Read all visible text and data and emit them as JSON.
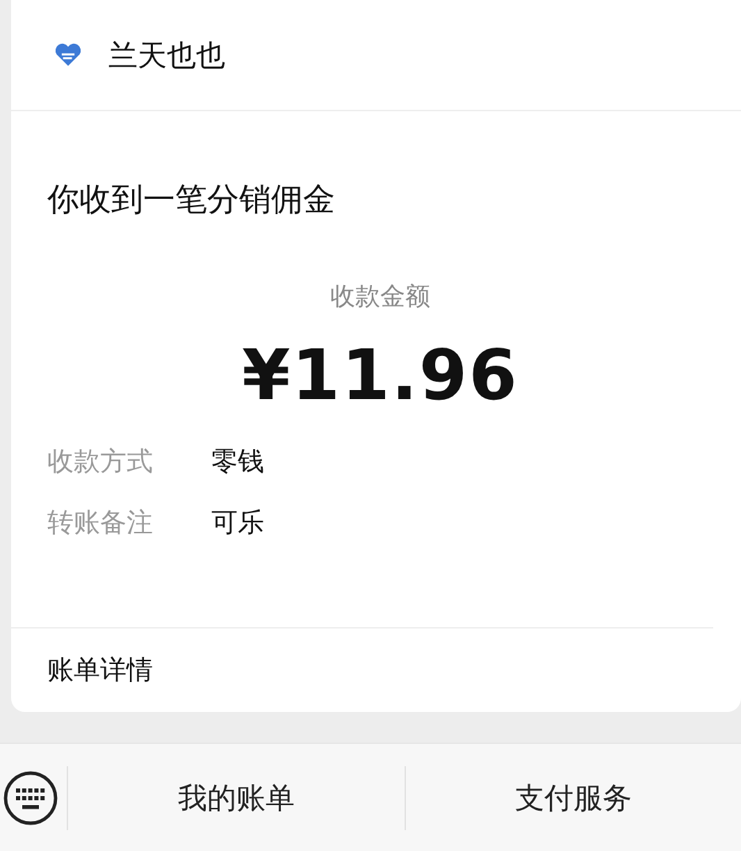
{
  "header": {
    "account_name": "兰天也也"
  },
  "message": {
    "title": "你收到一笔分销佣金",
    "amount_label": "收款金额",
    "amount": "¥11.96",
    "details": [
      {
        "label": "收款方式",
        "value": "零钱"
      },
      {
        "label": "转账备注",
        "value": "可乐"
      }
    ],
    "link": "账单详情"
  },
  "bottom_bar": {
    "menus": [
      "我的账单",
      "支付服务"
    ]
  }
}
